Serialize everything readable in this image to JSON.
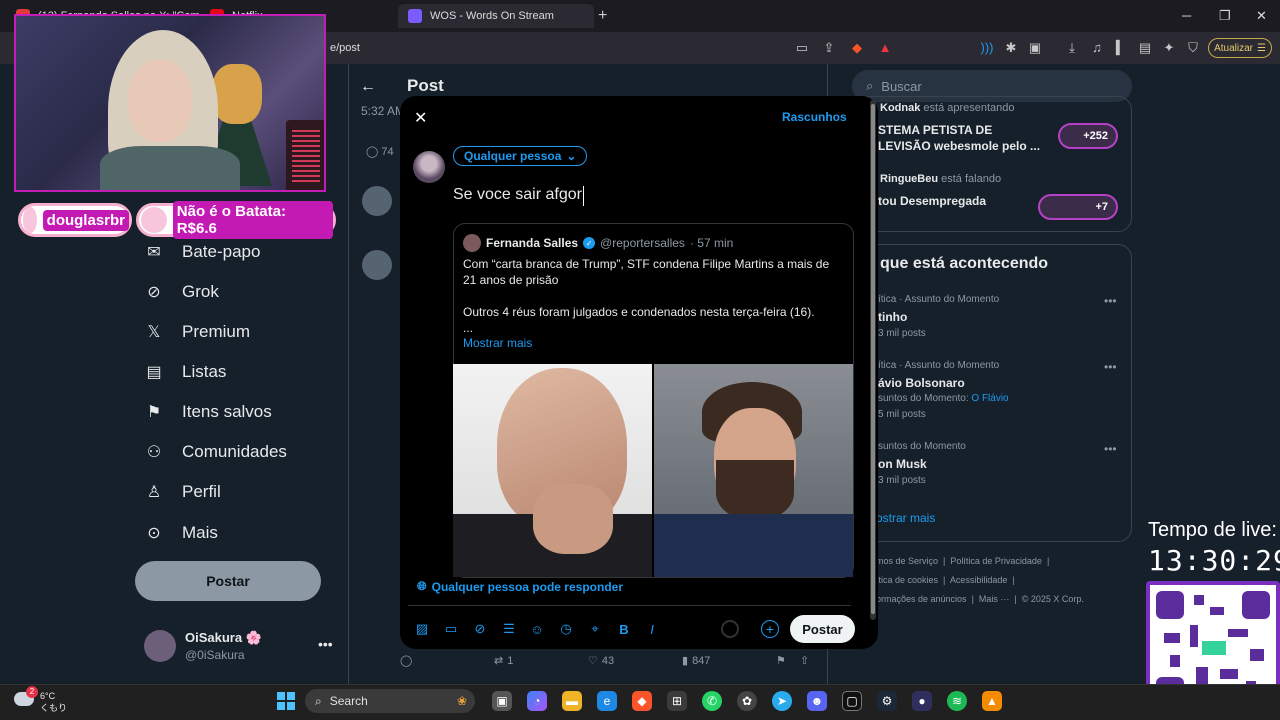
{
  "browser": {
    "tabs": [
      {
        "label": "(13) Fernando Salles no X: \"Com...",
        "color": "#e23a3a"
      },
      {
        "label": "WOS - Words On Stream",
        "color": "#7b5cff"
      },
      {
        "label": "Netflix",
        "color": "#e50914"
      }
    ],
    "url": "e/post",
    "update_label": "Atualizar"
  },
  "overlay": {
    "alert_name": "douglasrbr",
    "alert_msg": "Não é o Batata: R$6.6",
    "live_label": "Tempo de live:",
    "live_time": "13:30:29"
  },
  "nav": {
    "items": [
      {
        "label": "Bate-papo",
        "icon": "chat-icon"
      },
      {
        "label": "Grok",
        "icon": "grok-icon"
      },
      {
        "label": "Premium",
        "icon": "x-logo-icon"
      },
      {
        "label": "Listas",
        "icon": "list-icon"
      },
      {
        "label": "Itens salvos",
        "icon": "bookmark-icon"
      },
      {
        "label": "Comunidades",
        "icon": "communities-icon"
      },
      {
        "label": "Perfil",
        "icon": "profile-icon"
      },
      {
        "label": "Mais",
        "icon": "more-icon"
      }
    ],
    "post_label": "Postar",
    "account_name": "OiSakura 🌸",
    "account_handle": "@0iSakura"
  },
  "background": {
    "header": "Post",
    "time": "5:32 AM",
    "reply_count": "74",
    "retweets": "1",
    "likes": "43",
    "views": "847"
  },
  "sidebar": {
    "search_placeholder": "Buscar",
    "spaces": [
      {
        "host": "Kodnak",
        "status": "está apresentando",
        "title1": "STEMA PETISTA DE",
        "title2": "LEVISÃO webesmole pelo ...",
        "count": "+252"
      },
      {
        "host": "RingueBeu",
        "status": "está falando",
        "title1": "tou Desempregada",
        "title2": "",
        "count": "+7"
      }
    ],
    "trends_header": "que está acontecendo",
    "trends": [
      {
        "meta": "ítica · Assunto do Momento",
        "name": "tinho",
        "extra": "",
        "posts": "3 mil posts"
      },
      {
        "meta": "ítica · Assunto do Momento",
        "name": "ávio Bolsonaro",
        "extra_label": "suntos do Momento:",
        "extra_link": "O Flávio",
        "posts": "5 mil posts"
      },
      {
        "meta": "suntos do Momento",
        "name": "on Musk",
        "extra": "",
        "posts": "3 mil posts"
      }
    ],
    "show_more": "ostrar mais",
    "footer": [
      "mos de Serviço",
      "Política de Privacidade",
      "ítica de cookies",
      "Acessibilidade",
      "ormações de anúncios",
      "Mais ···",
      "© 2025 X Corp."
    ]
  },
  "modal": {
    "drafts": "Rascunhos",
    "audience": "Qualquer pessoa",
    "compose_text": "Se voce sair afgor",
    "reply_setting": "Qualquer pessoa pode responder",
    "post_label": "Postar",
    "quote": {
      "name": "Fernanda Salles",
      "handle": "@reportersalles",
      "time": "· 57 min",
      "line1": "Com “carta branca de Trump”, STF condena Filipe Martins a mais de 21 anos de prisão",
      "line2": "Outros 4 réus foram julgados e condenados nesta terça-feira (16).",
      "ellipsis": "...",
      "show_more": "Mostrar mais"
    }
  },
  "taskbar": {
    "temp": "6°C",
    "cond": "くもり",
    "weather_badge": "2",
    "search_label": "Search"
  }
}
